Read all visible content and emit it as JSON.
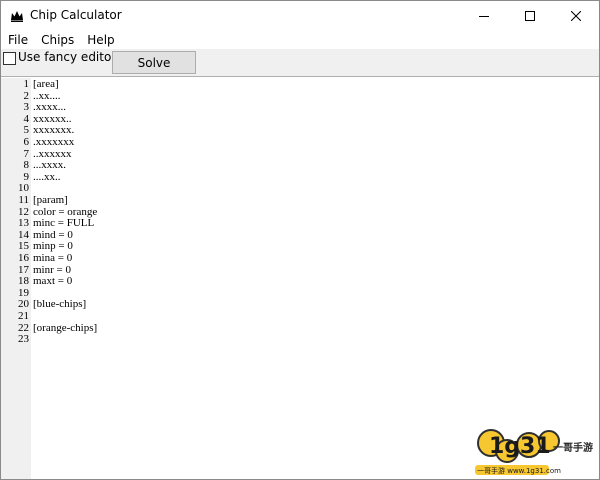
{
  "window": {
    "title": "Chip Calculator",
    "icon": "crown-icon"
  },
  "menu": [
    "File",
    "Chips",
    "Help"
  ],
  "toolbar": {
    "checkbox_label": "Use fancy editor",
    "checkbox_checked": false,
    "solve_label": "Solve"
  },
  "editor": {
    "lines": [
      "[area]",
      "..xx....",
      ".xxxx...",
      "xxxxxx..",
      "xxxxxxx.",
      ".xxxxxxx",
      "..xxxxxx",
      "...xxxx.",
      "....xx..",
      "",
      "[param]",
      "color = orange",
      "minc = FULL",
      "mind = 0",
      "minp = 0",
      "mina = 0",
      "minr = 0",
      "maxt = 0",
      "",
      "[blue-chips]",
      "",
      "[orange-chips]",
      ""
    ]
  },
  "watermark": {
    "logo": "1g31",
    "brand": "一哥手游",
    "site": "一哥手游 www.1g31.com"
  }
}
